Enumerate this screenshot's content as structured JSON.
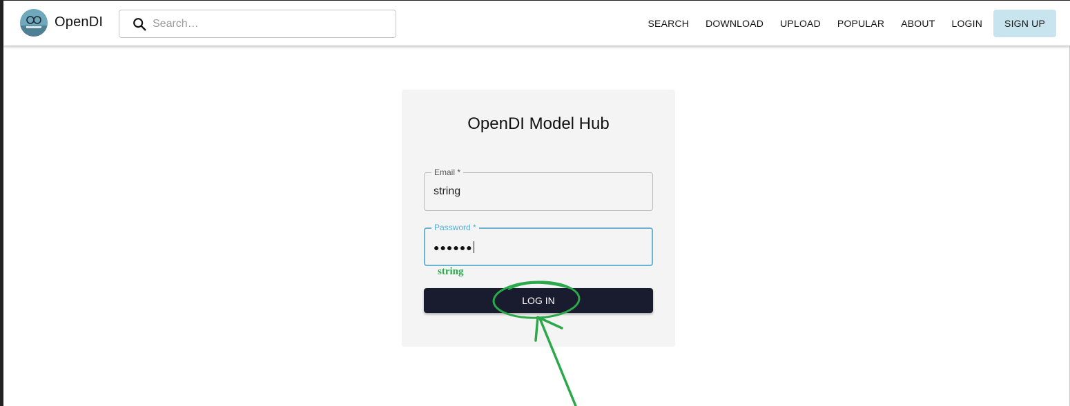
{
  "header": {
    "brand": "OpenDI",
    "search": {
      "placeholder": "Search…",
      "value": ""
    },
    "nav": {
      "search": "SEARCH",
      "download": "DOWNLOAD",
      "upload": "UPLOAD",
      "popular": "POPULAR",
      "about": "ABOUT",
      "login": "LOGIN",
      "signup": "SIGN UP"
    }
  },
  "login_form": {
    "title": "OpenDI Model Hub",
    "email_label": "Email *",
    "email_value": "string",
    "password_label": "Password *",
    "password_masked": "●●●●●●",
    "submit_label": "LOG IN"
  },
  "annotation": {
    "text": "string",
    "color": "#2aa84a"
  },
  "colors": {
    "accent_focus": "#6bb3d0",
    "signup_bg": "#c8e4ee",
    "button_dark": "#181c2e",
    "card_bg": "#f4f4f4"
  }
}
